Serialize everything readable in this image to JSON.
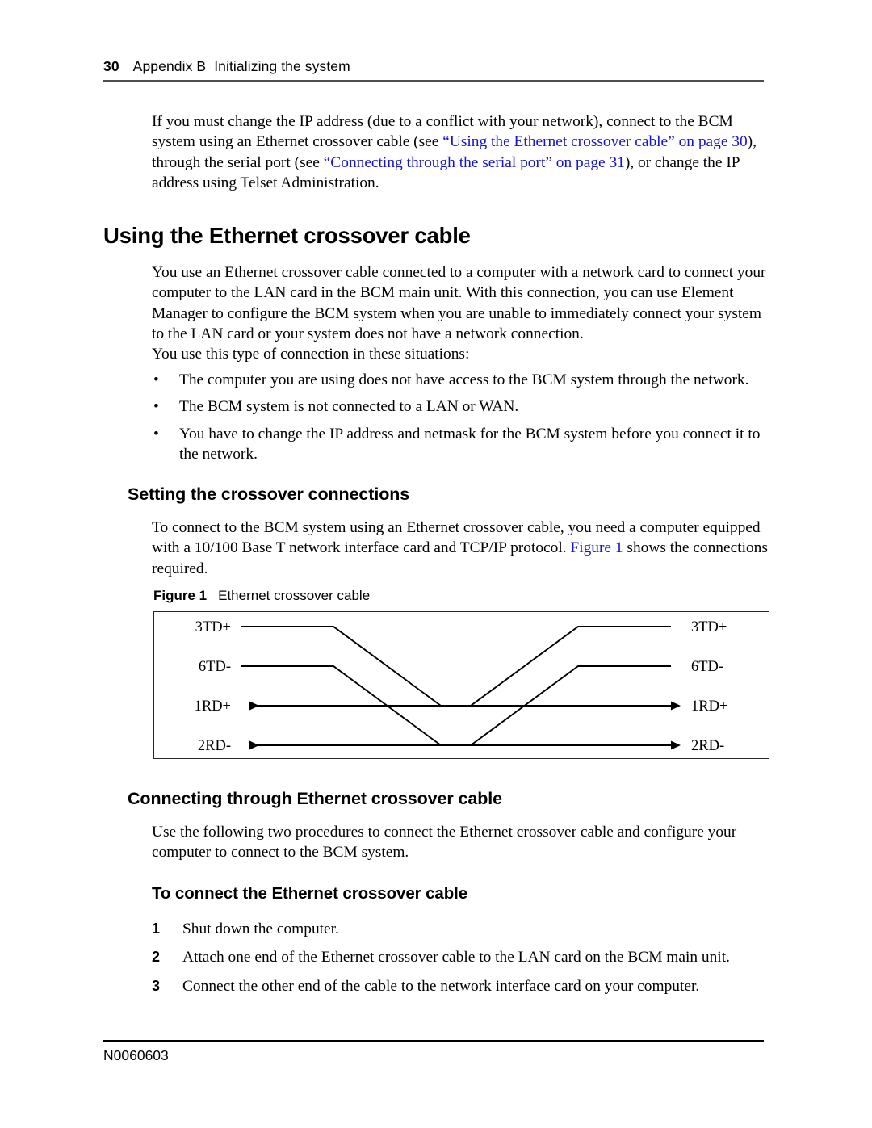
{
  "header": {
    "page_number": "30",
    "chapter": "Appendix B",
    "section": "Initializing the system"
  },
  "intro": {
    "part1": "If you must change the IP address (due to a conflict with your network), connect to the BCM system using an Ethernet crossover cable (see ",
    "link1": "“Using the Ethernet crossover cable” on page 30",
    "part2": "), through the serial port (see ",
    "link2": "“Connecting through the serial port” on page 31",
    "part3": "), or change the IP address using Telset Administration."
  },
  "section_main": {
    "title": "Using the Ethernet crossover cable",
    "paragraph": "You use an Ethernet crossover cable connected to a computer with a network card to connect your computer to the LAN card in the BCM main unit. With this connection, you can use Element Manager to configure the BCM system when you are unable to immediately connect your system to the LAN card or your system does not have a network connection.",
    "list_intro": "You use this type of connection in these situations:",
    "bullets": [
      "The computer you are using does not have access to the BCM system through the network.",
      "The BCM system is not connected to a LAN or WAN.",
      "You have to change the IP address and netmask for the BCM system before you connect it to the network."
    ]
  },
  "section_setting": {
    "title": "Setting the crossover connections",
    "para_part1": "To connect to the BCM system using an Ethernet crossover cable, you need a computer equipped with a 10/100 Base T network interface card and TCP/IP protocol. ",
    "para_link": "Figure 1",
    "para_part2": " shows the connections required."
  },
  "figure": {
    "number": "Figure 1",
    "caption": "Ethernet crossover cable",
    "left_pins": [
      "3TD+",
      "6TD-",
      "1RD+",
      "2RD-"
    ],
    "right_pins": [
      "3TD+",
      "6TD-",
      "1RD+",
      "2RD-"
    ]
  },
  "section_connecting": {
    "title": "Connecting through Ethernet crossover cable",
    "paragraph": "Use the following two procedures to connect the Ethernet crossover cable and configure your computer to connect to the BCM system."
  },
  "procedure": {
    "title": "To connect the Ethernet crossover cable",
    "steps": [
      {
        "number": "1",
        "text": "Shut down the computer."
      },
      {
        "number": "2",
        "text": "Attach one end of the Ethernet crossover cable to the LAN card on the BCM main unit."
      },
      {
        "number": "3",
        "text": "Connect the other end of the cable to the network interface card on your computer."
      }
    ]
  },
  "footer": {
    "document_id": "N0060603"
  },
  "colors": {
    "link": "#1414d0",
    "header_rule": "#4d4d4d",
    "footer_rule": "#000000",
    "figure_border": "#262626"
  }
}
